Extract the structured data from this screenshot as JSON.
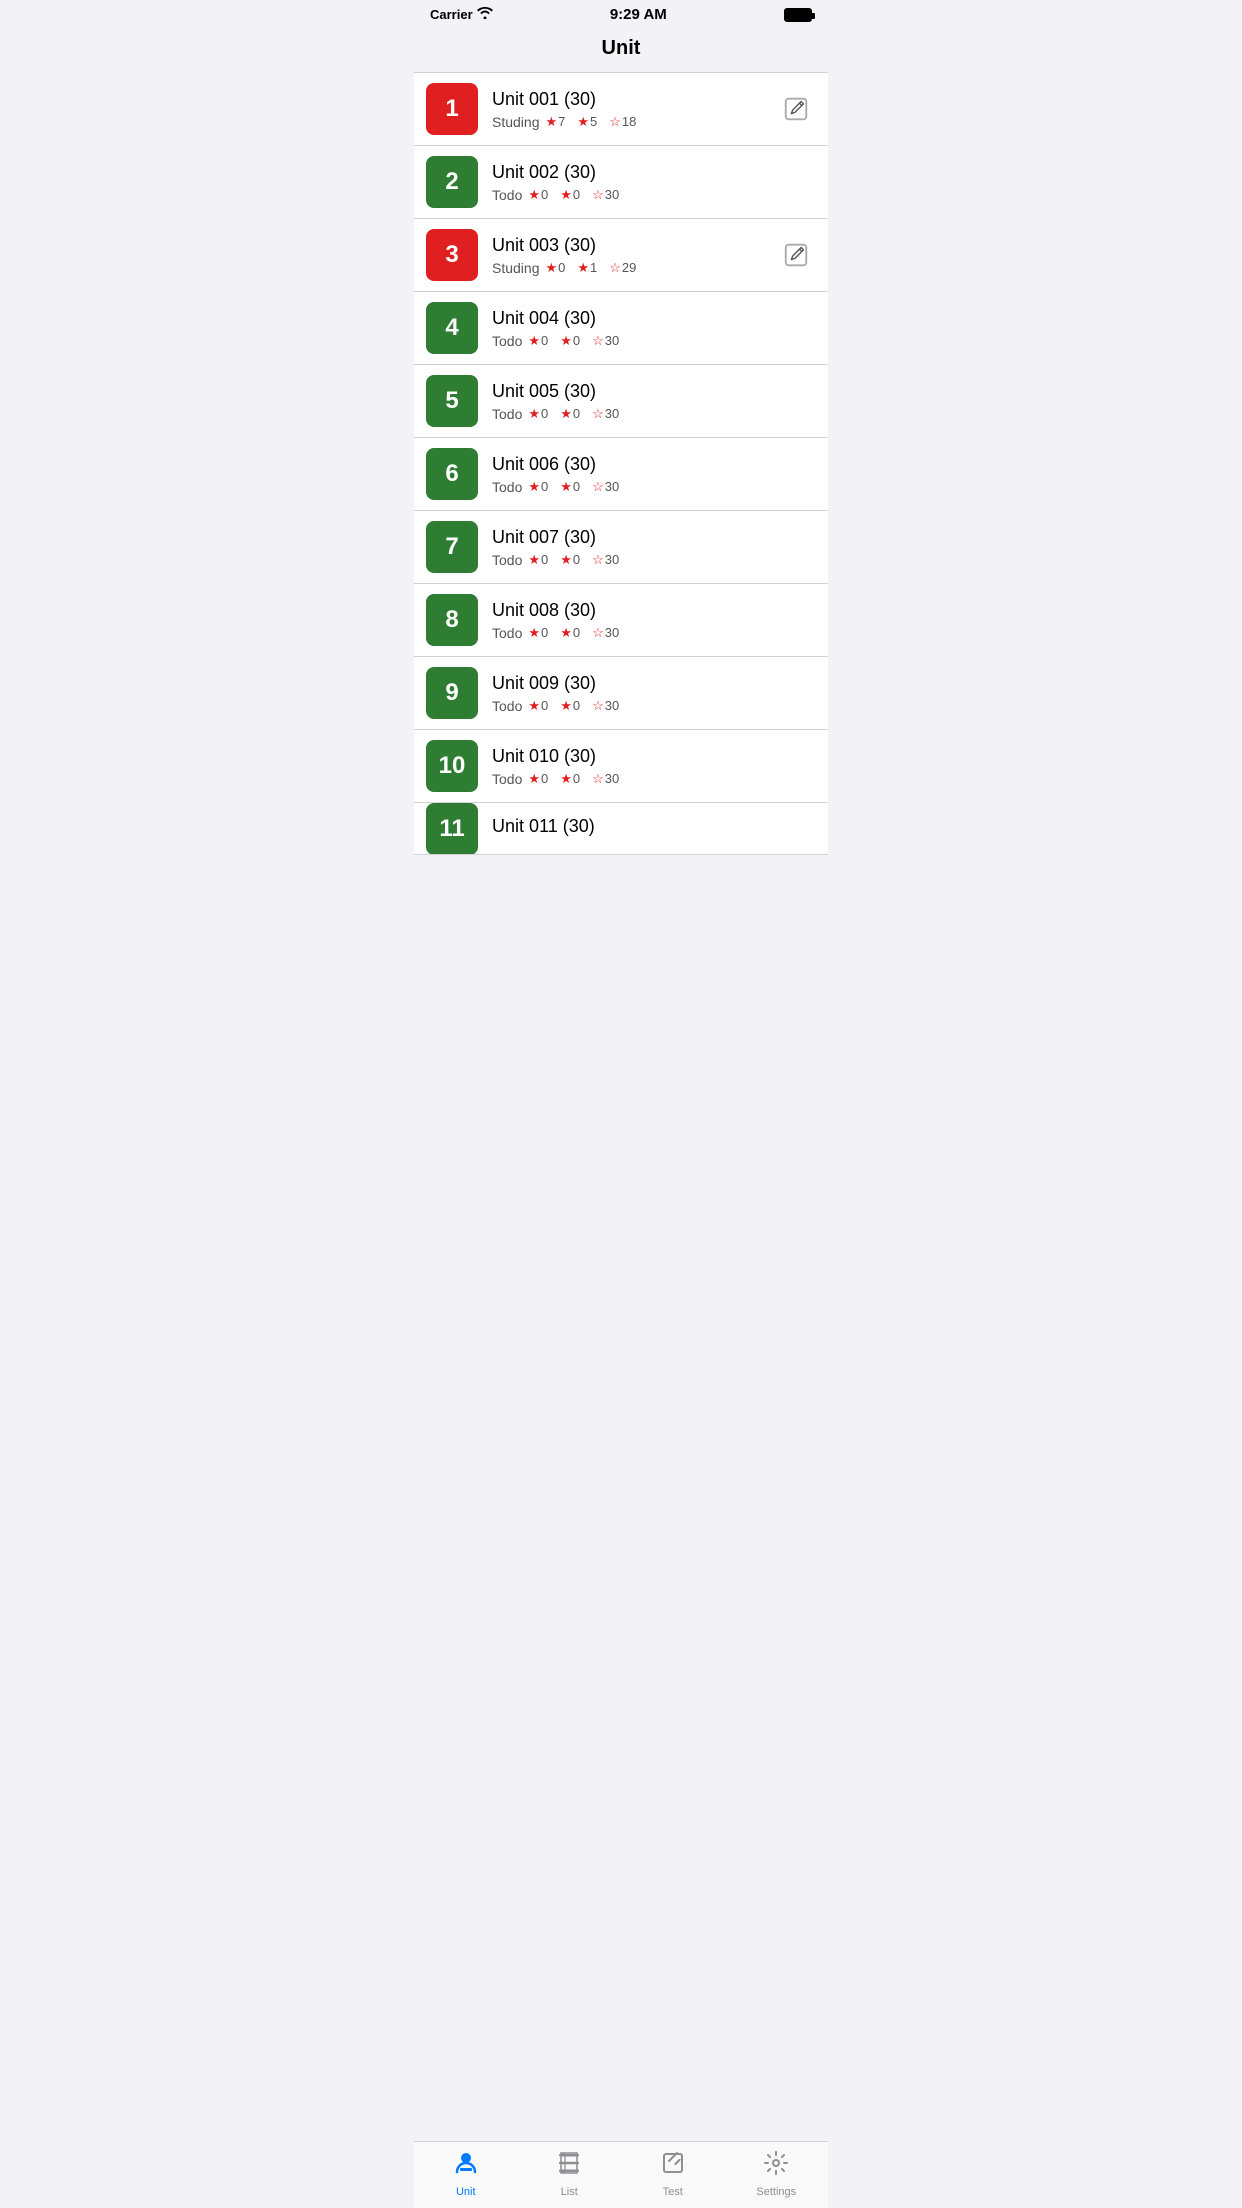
{
  "statusBar": {
    "carrier": "Carrier",
    "wifi": "📶",
    "time": "9:29 AM"
  },
  "pageTitle": "Unit",
  "units": [
    {
      "number": "1",
      "name": "Unit 001",
      "count": "(30)",
      "status": "Studing",
      "badgeColor": "red",
      "stars": [
        7,
        5,
        18
      ],
      "hasEdit": true
    },
    {
      "number": "2",
      "name": "Unit 002",
      "count": "(30)",
      "status": "Todo",
      "badgeColor": "green",
      "stars": [
        0,
        0,
        30
      ],
      "hasEdit": false
    },
    {
      "number": "3",
      "name": "Unit 003",
      "count": "(30)",
      "status": "Studing",
      "badgeColor": "red",
      "stars": [
        0,
        1,
        29
      ],
      "hasEdit": true
    },
    {
      "number": "4",
      "name": "Unit 004",
      "count": "(30)",
      "status": "Todo",
      "badgeColor": "green",
      "stars": [
        0,
        0,
        30
      ],
      "hasEdit": false
    },
    {
      "number": "5",
      "name": "Unit 005",
      "count": "(30)",
      "status": "Todo",
      "badgeColor": "green",
      "stars": [
        0,
        0,
        30
      ],
      "hasEdit": false
    },
    {
      "number": "6",
      "name": "Unit 006",
      "count": "(30)",
      "status": "Todo",
      "badgeColor": "green",
      "stars": [
        0,
        0,
        30
      ],
      "hasEdit": false
    },
    {
      "number": "7",
      "name": "Unit 007",
      "count": "(30)",
      "status": "Todo",
      "badgeColor": "green",
      "stars": [
        0,
        0,
        30
      ],
      "hasEdit": false
    },
    {
      "number": "8",
      "name": "Unit 008",
      "count": "(30)",
      "status": "Todo",
      "badgeColor": "green",
      "stars": [
        0,
        0,
        30
      ],
      "hasEdit": false
    },
    {
      "number": "9",
      "name": "Unit 009",
      "count": "(30)",
      "status": "Todo",
      "badgeColor": "green",
      "stars": [
        0,
        0,
        30
      ],
      "hasEdit": false
    },
    {
      "number": "10",
      "name": "Unit 010",
      "count": "(30)",
      "status": "Todo",
      "badgeColor": "green",
      "stars": [
        0,
        0,
        30
      ],
      "hasEdit": false
    },
    {
      "number": "11",
      "name": "Unit 011",
      "count": "(30)",
      "status": "",
      "badgeColor": "green",
      "stars": [],
      "hasEdit": false,
      "partial": true
    }
  ],
  "tabs": [
    {
      "id": "unit",
      "label": "Unit",
      "active": true
    },
    {
      "id": "list",
      "label": "List",
      "active": false
    },
    {
      "id": "test",
      "label": "Test",
      "active": false
    },
    {
      "id": "settings",
      "label": "Settings",
      "active": false
    }
  ]
}
